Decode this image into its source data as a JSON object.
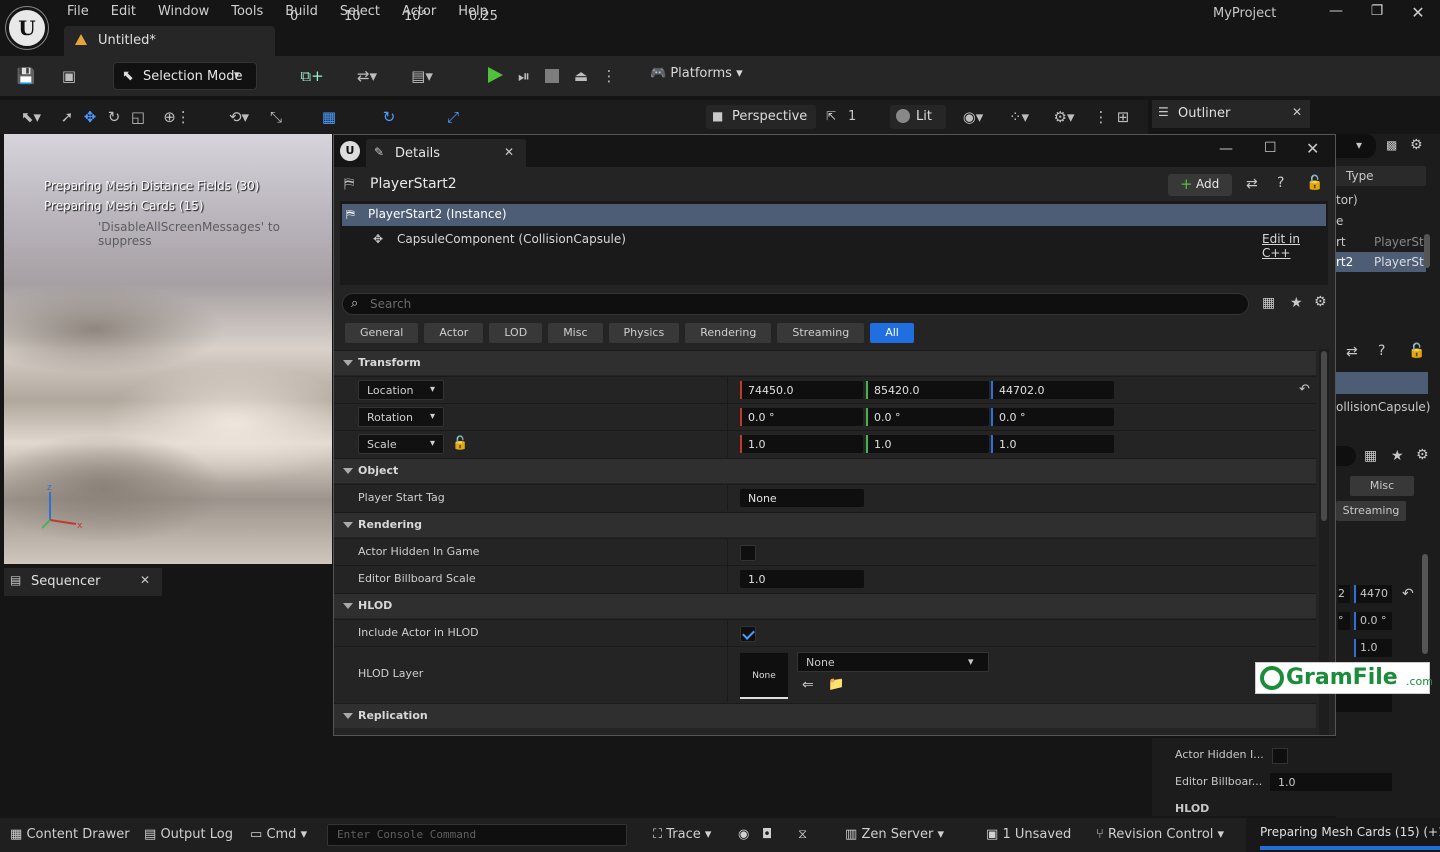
{
  "menu": [
    "File",
    "Edit",
    "Window",
    "Tools",
    "Build",
    "Select",
    "Actor",
    "Help"
  ],
  "project": "MyProject",
  "doc_tab": "Untitled*",
  "toolbar": {
    "selection_mode": "Selection Mode",
    "platforms": "Platforms"
  },
  "viewport_toolbar": {
    "snap_translate": "10",
    "snap_rotate": "10°",
    "snap_scale": "0.25",
    "snap_zero": "0",
    "perspective": "Perspective",
    "cam_speed": "1",
    "view_mode": "Lit"
  },
  "viewport": {
    "msg1": "Preparing Mesh Distance Fields (30)",
    "msg2": "Preparing Mesh Cards (15)",
    "suppress": "'DisableAllScreenMessages' to suppress"
  },
  "outliner": {
    "tab": "Outliner",
    "type_col": "Type",
    "rows": [
      "tor)",
      "e",
      "rt",
      "rt2"
    ],
    "types": [
      "PlayerSt",
      "PlayerSt"
    ],
    "capsule": "ollisionCapsule)",
    "misc": "Misc",
    "streaming": "Streaming",
    "loc_frag": "2",
    "loc_val": "4470",
    "rot_frag": "°",
    "rot_val": "0.0 °",
    "scale_val": "1.0",
    "actor_hidden": "Actor Hidden I...",
    "billboard": "Editor Billboar...",
    "billboard_val": "1.0",
    "hlod": "HLOD"
  },
  "sequencer": {
    "tab": "Sequencer"
  },
  "details": {
    "tab": "Details",
    "actor": "PlayerStart2",
    "add": "Add",
    "instance": "PlayerStart2 (Instance)",
    "component": "CapsuleComponent (CollisionCapsule)",
    "edit_cpp": "Edit in C++",
    "search_placeholder": "Search",
    "categories": [
      "General",
      "Actor",
      "LOD",
      "Misc",
      "Physics",
      "Rendering",
      "Streaming",
      "All"
    ],
    "sections": {
      "transform": "Transform",
      "object": "Object",
      "rendering": "Rendering",
      "hlod": "HLOD",
      "replication": "Replication"
    },
    "location": {
      "label": "Location",
      "x": "74450.0",
      "y": "85420.0",
      "z": "44702.0"
    },
    "rotation": {
      "label": "Rotation",
      "x": "0.0 °",
      "y": "0.0 °",
      "z": "0.0 °"
    },
    "scale": {
      "label": "Scale",
      "x": "1.0",
      "y": "1.0",
      "z": "1.0"
    },
    "player_start_tag": {
      "label": "Player Start Tag",
      "value": "None"
    },
    "actor_hidden": {
      "label": "Actor Hidden In Game",
      "checked": false
    },
    "billboard": {
      "label": "Editor Billboard Scale",
      "value": "1.0"
    },
    "include_hlod": {
      "label": "Include Actor in HLOD",
      "checked": true
    },
    "hlod_layer": {
      "label": "HLOD Layer",
      "thumb": "None",
      "value": "None"
    }
  },
  "status": {
    "content_drawer": "Content Drawer",
    "output_log": "Output Log",
    "cmd": "Cmd",
    "console_placeholder": "Enter Console Command",
    "trace": "Trace",
    "zen": "Zen Server",
    "unsaved": "1 Unsaved",
    "revision": "Revision Control",
    "progress": "Preparing Mesh Cards (15) (+1"
  },
  "watermark": {
    "text": "GramFile",
    "com": ".com"
  },
  "colors": {
    "accent": "#1f6fe0",
    "selection": "#4d5d75",
    "x_axis": "#c0392b",
    "y_axis": "#4caf50",
    "z_axis": "#2f6fd6"
  }
}
